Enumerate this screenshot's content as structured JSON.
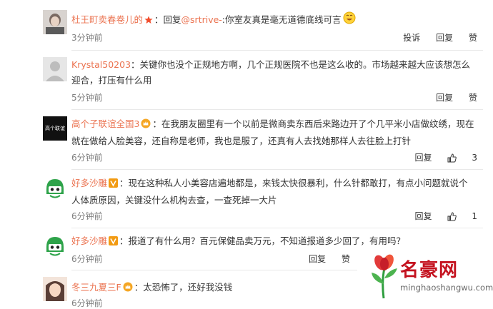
{
  "comments": [
    {
      "user": "杜王町卖春卷儿的",
      "text_prefix": "：回复",
      "mention": "@srtrive-",
      "text": ":你室友真是毫无道德底线可言",
      "time": "3分钟前",
      "actions": [
        "投诉",
        "回复",
        "赞"
      ]
    },
    {
      "user": "Krystal50203",
      "text": "：关键你也没个正规地方啊，几个正规医院不也是这么收的。市场越来越大应该想怎么迎合，打压有什么用",
      "time": "5分钟前",
      "actions": [
        "回复",
        "赞"
      ]
    },
    {
      "user": "高个子联谊全国3",
      "avatar_text": "高个联谊",
      "text": "：在我朋友圈里有一个以前是微商卖东西后来路边开了个几平米小店做纹绣，现在就在做给人脸美容，还自称是老师，我也是服了，还真有人去找她那样人去往脸上打针",
      "time": "6分钟前",
      "actions": [
        "回复"
      ],
      "likes": "3"
    },
    {
      "user": "好多沙雕",
      "text": "：现在这种私人小美容店遍地都是，来钱太快很暴利，什么针都敢打，有点小问题就说个人体质原因，关键没什么机构去查，一查死掉一大片",
      "time": "6分钟前",
      "actions": [
        "回复"
      ],
      "likes": "1"
    },
    {
      "user": "好多沙雕",
      "text": "：报道了有什么用？百元保健品卖万元，不知道报道多少回了，有用吗？",
      "time": "6分钟前",
      "actions": [
        "回复",
        "赞"
      ]
    },
    {
      "user": "冬三九夏三F",
      "text": "：太恐怖了，还好我没钱",
      "time": "6分钟前"
    }
  ],
  "watermark": {
    "title": "名豪网",
    "url": "minghaoshangwu.com"
  },
  "colors": {
    "username": "#eb7350",
    "timestamp": "#808080",
    "divider": "#e9e9e9",
    "watermark": "#c4121f"
  }
}
